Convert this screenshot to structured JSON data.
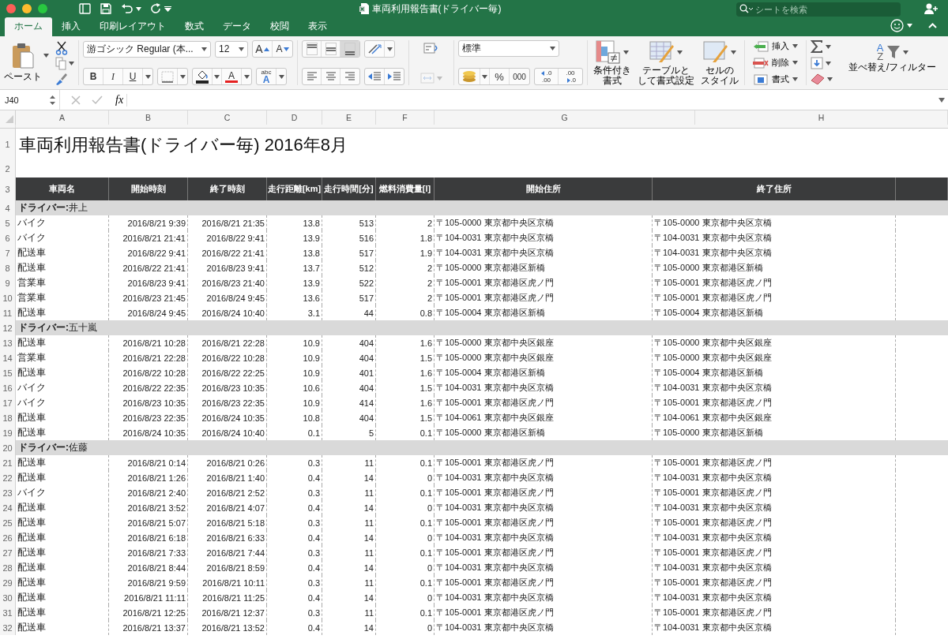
{
  "window": {
    "title": "車両利用報告書(ドライバー毎)",
    "search": {
      "placeholder": "シートを検索"
    }
  },
  "tabs": [
    {
      "label": "ホーム",
      "selected": true
    },
    {
      "label": "挿入",
      "selected": false
    },
    {
      "label": "印刷レイアウト",
      "selected": false
    },
    {
      "label": "数式",
      "selected": false
    },
    {
      "label": "データ",
      "selected": false
    },
    {
      "label": "校閲",
      "selected": false
    },
    {
      "label": "表示",
      "selected": false
    }
  ],
  "ribbon": {
    "paste": "ペースト",
    "font": {
      "name": "游ゴシック Regular (本...",
      "size": "12",
      "grow": "A",
      "shrink": "A",
      "font_color": "A",
      "text_effects": [
        "abc",
        "A"
      ]
    },
    "format_buttons": [
      {
        "kind": "bold",
        "label": "B"
      },
      {
        "kind": "italic",
        "label": "I"
      },
      {
        "kind": "underline",
        "label": "U"
      }
    ],
    "vertical_align": [
      {
        "kind": "top",
        "selected": false
      },
      {
        "kind": "middle",
        "selected": false
      },
      {
        "kind": "bottom",
        "selected": true
      }
    ],
    "merge": {
      "disabled": true
    },
    "number": {
      "format": "標準",
      "percent": "%",
      "thousands": "000"
    },
    "decimal_buttons": [
      {
        "kind": "increase",
        "lines": [
          ".0",
          ".00"
        ]
      },
      {
        "kind": "decrease",
        "lines": [
          ".00",
          ".0"
        ]
      }
    ],
    "styles": [
      {
        "kind": "conditional",
        "lines": [
          "条件付き",
          "書式"
        ]
      },
      {
        "kind": "table",
        "lines": [
          "テーブルと",
          "して書式設定"
        ]
      },
      {
        "kind": "cell",
        "lines": [
          "セルの",
          "スタイル"
        ]
      }
    ],
    "cells": [
      {
        "kind": "insert",
        "label": "挿入"
      },
      {
        "kind": "delete",
        "label": "削除"
      },
      {
        "kind": "format",
        "label": "書式"
      }
    ],
    "sort_filter": {
      "label": "並べ替え/フィルター",
      "icon_letters": [
        "A",
        "Z"
      ]
    }
  },
  "formula_bar": {
    "name_box": "J40",
    "function_label": "fx"
  },
  "sheet": {
    "column_letters": [
      "A",
      "B",
      "C",
      "D",
      "E",
      "F",
      "G",
      "H"
    ],
    "title_row": {
      "number": "1",
      "text": "車両利用報告書(ドライバー毎) 2016年8月"
    },
    "blank_row": {
      "number": "2"
    },
    "header_row": {
      "number": "3",
      "cells": [
        "車両名",
        "開始時刻",
        "終了時刻",
        "走行距離[km]",
        "走行時間[分]",
        "燃料消費量[l]",
        "開始住所",
        "終了住所"
      ]
    },
    "groups": [
      {
        "number": "4",
        "label": "**ドライバー:**井上",
        "rows": [
          {
            "number": "5",
            "cells": [
              "バイク",
              "2016/8/21 9:39",
              "2016/8/21 21:35",
              "13.8",
              "513",
              "2",
              "〒105-0000 東京都中央区京橋",
              "〒105-0000 東京都中央区京橋"
            ]
          },
          {
            "number": "6",
            "cells": [
              "バイク",
              "2016/8/21 21:41",
              "2016/8/22 9:41",
              "13.9",
              "516",
              "1.8",
              "〒104-0031 東京都中央区京橋",
              "〒104-0031 東京都中央区京橋"
            ]
          },
          {
            "number": "7",
            "cells": [
              "配送車",
              "2016/8/22 9:41",
              "2016/8/22 21:41",
              "13.8",
              "517",
              "1.9",
              "〒104-0031 東京都中央区京橋",
              "〒104-0031 東京都中央区京橋"
            ]
          },
          {
            "number": "8",
            "cells": [
              "配送車",
              "2016/8/22 21:41",
              "2016/8/23 9:41",
              "13.7",
              "512",
              "2",
              "〒105-0000 東京都港区新橋",
              "〒105-0000 東京都港区新橋"
            ]
          },
          {
            "number": "9",
            "cells": [
              "営業車",
              "2016/8/23 9:41",
              "2016/8/23 21:40",
              "13.9",
              "522",
              "2",
              "〒105-0001 東京都港区虎ノ門",
              "〒105-0001 東京都港区虎ノ門"
            ]
          },
          {
            "number": "10",
            "cells": [
              "営業車",
              "2016/8/23 21:45",
              "2016/8/24 9:45",
              "13.6",
              "517",
              "2",
              "〒105-0001 東京都港区虎ノ門",
              "〒105-0001 東京都港区虎ノ門"
            ]
          },
          {
            "number": "11",
            "cells": [
              "配送車",
              "2016/8/24 9:45",
              "2016/8/24 10:40",
              "3.1",
              "44",
              "0.8",
              "〒105-0004 東京都港区新橋",
              "〒105-0004 東京都港区新橋"
            ]
          }
        ]
      },
      {
        "number": "12",
        "label": "**ドライバー:**五十嵐",
        "rows": [
          {
            "number": "13",
            "cells": [
              "配送車",
              "2016/8/21 10:28",
              "2016/8/21 22:28",
              "10.9",
              "404",
              "1.6",
              "〒105-0000 東京都中央区銀座",
              "〒105-0000 東京都中央区銀座"
            ]
          },
          {
            "number": "14",
            "cells": [
              "営業車",
              "2016/8/21 22:28",
              "2016/8/22 10:28",
              "10.9",
              "404",
              "1.5",
              "〒105-0000 東京都中央区銀座",
              "〒105-0000 東京都中央区銀座"
            ]
          },
          {
            "number": "15",
            "cells": [
              "配送車",
              "2016/8/22 10:28",
              "2016/8/22 22:25",
              "10.9",
              "401",
              "1.6",
              "〒105-0004 東京都港区新橋",
              "〒105-0004 東京都港区新橋"
            ]
          },
          {
            "number": "16",
            "cells": [
              "バイク",
              "2016/8/22 22:35",
              "2016/8/23 10:35",
              "10.6",
              "404",
              "1.5",
              "〒104-0031 東京都中央区京橋",
              "〒104-0031 東京都中央区京橋"
            ]
          },
          {
            "number": "17",
            "cells": [
              "バイク",
              "2016/8/23 10:35",
              "2016/8/23 22:35",
              "10.9",
              "414",
              "1.6",
              "〒105-0001 東京都港区虎ノ門",
              "〒105-0001 東京都港区虎ノ門"
            ]
          },
          {
            "number": "18",
            "cells": [
              "配送車",
              "2016/8/23 22:35",
              "2016/8/24 10:35",
              "10.8",
              "404",
              "1.5",
              "〒104-0061 東京都中央区銀座",
              "〒104-0061 東京都中央区銀座"
            ]
          },
          {
            "number": "19",
            "cells": [
              "配送車",
              "2016/8/24 10:35",
              "2016/8/24 10:40",
              "0.1",
              "5",
              "0.1",
              "〒105-0000 東京都港区新橋",
              "〒105-0000 東京都港区新橋"
            ]
          }
        ]
      },
      {
        "number": "20",
        "label": "**ドライバー:**佐藤",
        "rows": [
          {
            "number": "21",
            "cells": [
              "配送車",
              "2016/8/21 0:14",
              "2016/8/21 0:26",
              "0.3",
              "11",
              "0.1",
              "〒105-0001 東京都港区虎ノ門",
              "〒105-0001 東京都港区虎ノ門"
            ]
          },
          {
            "number": "22",
            "cells": [
              "配送車",
              "2016/8/21 1:26",
              "2016/8/21 1:40",
              "0.4",
              "14",
              "0",
              "〒104-0031 東京都中央区京橋",
              "〒104-0031 東京都中央区京橋"
            ]
          },
          {
            "number": "23",
            "cells": [
              "バイク",
              "2016/8/21 2:40",
              "2016/8/21 2:52",
              "0.3",
              "11",
              "0.1",
              "〒105-0001 東京都港区虎ノ門",
              "〒105-0001 東京都港区虎ノ門"
            ]
          },
          {
            "number": "24",
            "cells": [
              "配送車",
              "2016/8/21 3:52",
              "2016/8/21 4:07",
              "0.4",
              "14",
              "0",
              "〒104-0031 東京都中央区京橋",
              "〒104-0031 東京都中央区京橋"
            ]
          },
          {
            "number": "25",
            "cells": [
              "配送車",
              "2016/8/21 5:07",
              "2016/8/21 5:18",
              "0.3",
              "11",
              "0.1",
              "〒105-0001 東京都港区虎ノ門",
              "〒105-0001 東京都港区虎ノ門"
            ]
          },
          {
            "number": "26",
            "cells": [
              "配送車",
              "2016/8/21 6:18",
              "2016/8/21 6:33",
              "0.4",
              "14",
              "0",
              "〒104-0031 東京都中央区京橋",
              "〒104-0031 東京都中央区京橋"
            ]
          },
          {
            "number": "27",
            "cells": [
              "配送車",
              "2016/8/21 7:33",
              "2016/8/21 7:44",
              "0.3",
              "11",
              "0.1",
              "〒105-0001 東京都港区虎ノ門",
              "〒105-0001 東京都港区虎ノ門"
            ]
          },
          {
            "number": "28",
            "cells": [
              "配送車",
              "2016/8/21 8:44",
              "2016/8/21 8:59",
              "0.4",
              "14",
              "0",
              "〒104-0031 東京都中央区京橋",
              "〒104-0031 東京都中央区京橋"
            ]
          },
          {
            "number": "29",
            "cells": [
              "配送車",
              "2016/8/21 9:59",
              "2016/8/21 10:11",
              "0.3",
              "11",
              "0.1",
              "〒105-0001 東京都港区虎ノ門",
              "〒105-0001 東京都港区虎ノ門"
            ]
          },
          {
            "number": "30",
            "cells": [
              "配送車",
              "2016/8/21 11:11",
              "2016/8/21 11:25",
              "0.4",
              "14",
              "0",
              "〒104-0031 東京都中央区京橋",
              "〒104-0031 東京都中央区京橋"
            ]
          },
          {
            "number": "31",
            "cells": [
              "配送車",
              "2016/8/21 12:25",
              "2016/8/21 12:37",
              "0.3",
              "11",
              "0.1",
              "〒105-0001 東京都港区虎ノ門",
              "〒105-0001 東京都港区虎ノ門"
            ]
          },
          {
            "number": "32",
            "cells": [
              "配送車",
              "2016/8/21 13:37",
              "2016/8/21 13:52",
              "0.4",
              "14",
              "0",
              "〒104-0031 東京都中央区京橋",
              "〒104-0031 東京都中央区京橋"
            ]
          }
        ]
      }
    ]
  }
}
